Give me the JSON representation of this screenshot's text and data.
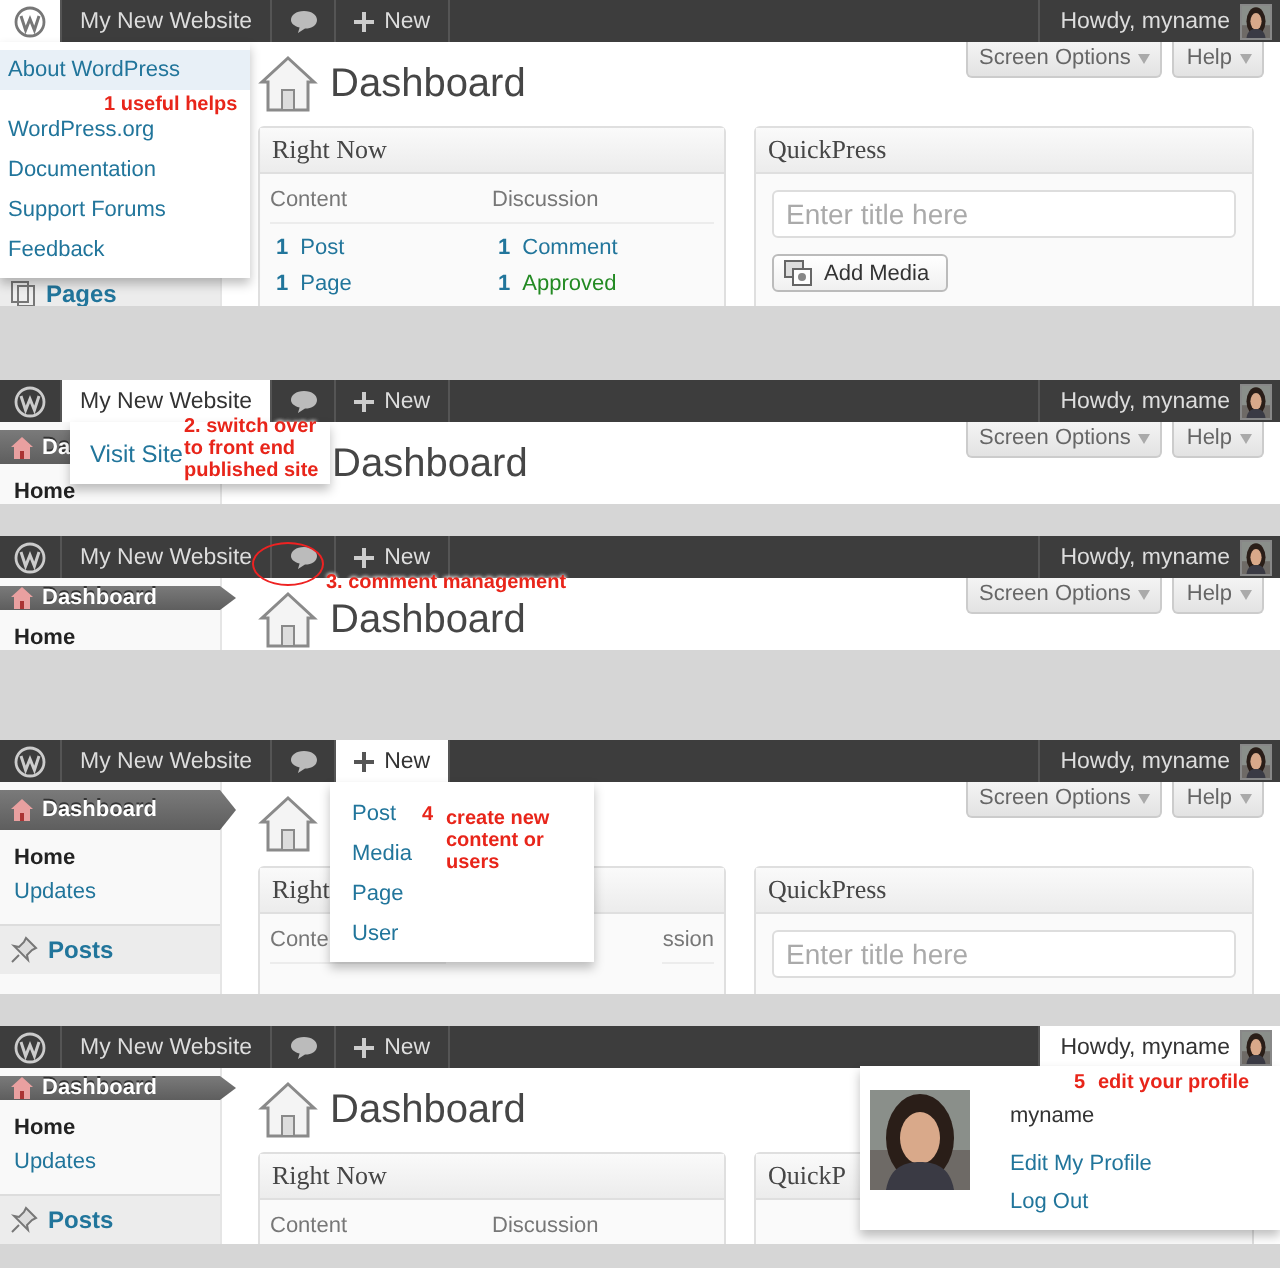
{
  "panels": [
    {
      "admin_bar": [
        {
          "kind": "logo",
          "open": true
        },
        {
          "kind": "site",
          "label": "My New Website",
          "open": false
        },
        {
          "kind": "comments",
          "open": false
        },
        {
          "kind": "new",
          "label": "New",
          "open": false
        },
        {
          "kind": "account",
          "label": "Howdy, myname",
          "open": false
        }
      ],
      "menu": [
        {
          "label": "About WordPress",
          "selected": true
        },
        {
          "label": "WordPress.org",
          "selected": false
        },
        {
          "label": "Documentation",
          "selected": false
        },
        {
          "label": "Support Forums",
          "selected": false
        },
        {
          "label": "Feedback",
          "selected": false
        }
      ],
      "annotations": [
        "1 useful helps"
      ],
      "sidebar": [
        {
          "label": "Pages",
          "kind": "section"
        }
      ],
      "page_title": "Dashboard",
      "screen_options": "Screen Options",
      "help": "Help",
      "right_now": {
        "title": "Right Now",
        "columns": [
          {
            "heading": "Content",
            "rows": [
              {
                "count": "1",
                "label": "Post",
                "kind": "link"
              },
              {
                "count": "1",
                "label": "Page",
                "kind": "link"
              }
            ]
          },
          {
            "heading": "Discussion",
            "rows": [
              {
                "count": "1",
                "label": "Comment",
                "kind": "link"
              },
              {
                "count": "1",
                "label": "Approved",
                "kind": "approved"
              }
            ]
          }
        ]
      },
      "quickpress": {
        "title": "QuickPress",
        "placeholder": "Enter title here",
        "button": "Add Media"
      }
    },
    {
      "admin_bar": [
        {
          "kind": "logo",
          "open": false
        },
        {
          "kind": "site",
          "label": "My New Website",
          "open": true
        },
        {
          "kind": "comments",
          "open": false
        },
        {
          "kind": "new",
          "label": "New",
          "open": false
        },
        {
          "kind": "account",
          "label": "Howdy, myname",
          "open": false
        }
      ],
      "menu": [
        {
          "label": "Visit Site",
          "selected": false
        }
      ],
      "annotations": [
        "2. switch over\nto front end\npublished site"
      ],
      "sidebar": [
        {
          "label": "Da",
          "kind": "top",
          "selected": true
        },
        {
          "label": "Home",
          "kind": "sub",
          "selected": true
        }
      ],
      "page_title": "Dashboard",
      "screen_options": "Screen Options",
      "help": "Help"
    },
    {
      "admin_bar": [
        {
          "kind": "logo",
          "open": false
        },
        {
          "kind": "site",
          "label": "My New Website",
          "open": false
        },
        {
          "kind": "comments",
          "open": false,
          "circled": true
        },
        {
          "kind": "new",
          "label": "New",
          "open": false
        },
        {
          "kind": "account",
          "label": "Howdy, myname",
          "open": false
        }
      ],
      "annotations": [
        "3. comment management"
      ],
      "sidebar": [
        {
          "label": "Dashboard",
          "kind": "top",
          "selected": true
        },
        {
          "label": "Home",
          "kind": "sub",
          "selected": true
        }
      ],
      "page_title": "Dashboard",
      "screen_options": "Screen Options",
      "help": "Help"
    },
    {
      "admin_bar": [
        {
          "kind": "logo",
          "open": false
        },
        {
          "kind": "site",
          "label": "My New Website",
          "open": false
        },
        {
          "kind": "comments",
          "open": false
        },
        {
          "kind": "new",
          "label": "New",
          "open": true
        },
        {
          "kind": "account",
          "label": "Howdy, myname",
          "open": false
        }
      ],
      "menu": [
        {
          "label": "Post",
          "selected": false
        },
        {
          "label": "Media",
          "selected": false
        },
        {
          "label": "Page",
          "selected": false
        },
        {
          "label": "User",
          "selected": false
        }
      ],
      "annotations": [
        "4",
        "create new\ncontent or\nusers"
      ],
      "sidebar": [
        {
          "label": "Dashboard",
          "kind": "top",
          "selected": true
        },
        {
          "label": "Home",
          "kind": "sub",
          "selected": true
        },
        {
          "label": "Updates",
          "kind": "sub",
          "selected": false
        },
        {
          "label": "Posts",
          "kind": "section"
        }
      ],
      "screen_options": "Screen Options",
      "help": "Help",
      "right_now": {
        "title": "Right",
        "columns": [
          {
            "heading": "Conte"
          },
          {
            "heading": "ssion"
          }
        ]
      },
      "quickpress": {
        "title": "QuickPress",
        "placeholder": "Enter title here"
      }
    },
    {
      "admin_bar": [
        {
          "kind": "logo",
          "open": false
        },
        {
          "kind": "site",
          "label": "My New Website",
          "open": false
        },
        {
          "kind": "comments",
          "open": false
        },
        {
          "kind": "new",
          "label": "New",
          "open": false
        },
        {
          "kind": "account",
          "label": "Howdy, myname",
          "open": true
        }
      ],
      "account": {
        "name": "myname",
        "items": [
          "Edit My Profile",
          "Log Out"
        ]
      },
      "annotations": [
        "5",
        "edit your profile"
      ],
      "sidebar": [
        {
          "label": "Dashboard",
          "kind": "top",
          "selected": true
        },
        {
          "label": "Home",
          "kind": "sub",
          "selected": true
        },
        {
          "label": "Updates",
          "kind": "sub",
          "selected": false
        },
        {
          "label": "Posts",
          "kind": "section"
        }
      ],
      "page_title": "Dashboard",
      "right_now": {
        "title": "Right Now",
        "columns": [
          {
            "heading": "Content"
          },
          {
            "heading": "Discussion"
          }
        ]
      },
      "quickpress": {
        "title": "QuickP"
      }
    }
  ]
}
